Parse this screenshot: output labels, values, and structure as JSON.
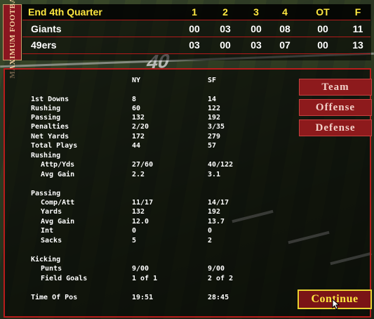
{
  "logo": {
    "text": "MAXIMUM FOOTBALL"
  },
  "scoreboard": {
    "quarter": "End 4th Quarter",
    "columns": [
      "1",
      "2",
      "3",
      "4",
      "OT",
      "F"
    ],
    "teams": [
      {
        "name": "Giants",
        "scores": [
          "00",
          "03",
          "00",
          "08",
          "00",
          "11"
        ]
      },
      {
        "name": "49ers",
        "scores": [
          "03",
          "00",
          "03",
          "07",
          "00",
          "13"
        ]
      }
    ]
  },
  "field": {
    "yard_marker": "40"
  },
  "stats": {
    "headers": {
      "home": "NY",
      "away": "SF"
    },
    "rows": [
      {
        "label": "1st Downs",
        "ny": "8",
        "sf": "14",
        "indent": false
      },
      {
        "label": "Rushing",
        "ny": "60",
        "sf": "122",
        "indent": false
      },
      {
        "label": "Passing",
        "ny": "132",
        "sf": "192",
        "indent": false
      },
      {
        "label": "Penalties",
        "ny": "2/20",
        "sf": "3/35",
        "indent": false
      },
      {
        "label": "Net Yards",
        "ny": "172",
        "sf": "279",
        "indent": false
      },
      {
        "label": "Total Plays",
        "ny": "44",
        "sf": "57",
        "indent": false
      },
      {
        "label": "Rushing",
        "ny": "",
        "sf": "",
        "indent": false
      },
      {
        "label": "Attp/Yds",
        "ny": "27/60",
        "sf": "40/122",
        "indent": true
      },
      {
        "label": "Avg Gain",
        "ny": "2.2",
        "sf": "3.1",
        "indent": true
      },
      {
        "label": "Passing",
        "ny": "",
        "sf": "",
        "indent": false
      },
      {
        "label": "Comp/Att",
        "ny": "11/17",
        "sf": "14/17",
        "indent": true
      },
      {
        "label": "Yards",
        "ny": "132",
        "sf": "192",
        "indent": true
      },
      {
        "label": "Avg Gain",
        "ny": "12.0",
        "sf": "13.7",
        "indent": true
      },
      {
        "label": "Int",
        "ny": "0",
        "sf": "0",
        "indent": true
      },
      {
        "label": "Sacks",
        "ny": "5",
        "sf": "2",
        "indent": true
      },
      {
        "label": "Kicking",
        "ny": "",
        "sf": "",
        "indent": false
      },
      {
        "label": "Punts",
        "ny": "9/00",
        "sf": "9/00",
        "indent": true
      },
      {
        "label": "Field Goals",
        "ny": "1 of 1",
        "sf": "2 of 2",
        "indent": true
      },
      {
        "label": "Time Of Pos",
        "ny": "19:51",
        "sf": "28:45",
        "indent": false
      }
    ]
  },
  "buttons": {
    "team": "Team",
    "offense": "Offense",
    "defense": "Defense",
    "continue": "Continue"
  },
  "colors": {
    "accent_yellow": "#ffe840",
    "button_red": "#8d1a1c",
    "border_red": "#b81c1c"
  }
}
